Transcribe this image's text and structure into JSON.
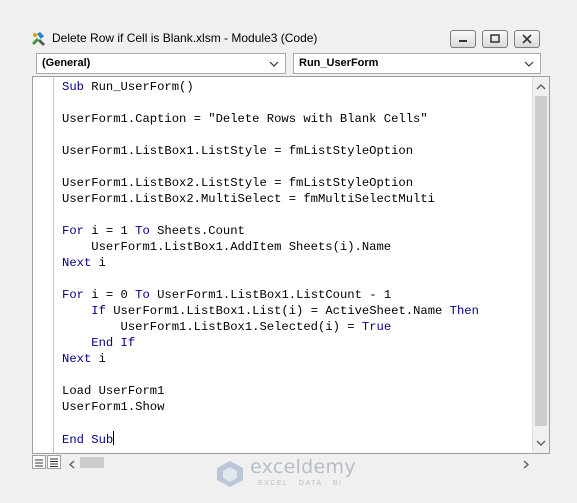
{
  "window": {
    "title": "Delete Row if Cell is Blank.xlsm - Module3 (Code)"
  },
  "combos": {
    "object": "(General)",
    "procedure": "Run_UserForm"
  },
  "code": {
    "lines": [
      [
        {
          "t": "Sub",
          "k": true
        },
        {
          "t": " Run_UserForm()"
        }
      ],
      [],
      [
        {
          "t": "UserForm1.Caption = \"Delete Rows with Blank Cells\""
        }
      ],
      [],
      [
        {
          "t": "UserForm1.ListBox1.ListStyle = fmListStyleOption"
        }
      ],
      [],
      [
        {
          "t": "UserForm1.ListBox2.ListStyle = fmListStyleOption"
        }
      ],
      [
        {
          "t": "UserForm1.ListBox2.MultiSelect = fmMultiSelectMulti"
        }
      ],
      [],
      [
        {
          "t": "For",
          "k": true
        },
        {
          "t": " i = 1 "
        },
        {
          "t": "To",
          "k": true
        },
        {
          "t": " Sheets.Count"
        }
      ],
      [
        {
          "t": "    UserForm1.ListBox1.AddItem Sheets(i).Name"
        }
      ],
      [
        {
          "t": "Next",
          "k": true
        },
        {
          "t": " i"
        }
      ],
      [],
      [
        {
          "t": "For",
          "k": true
        },
        {
          "t": " i = 0 "
        },
        {
          "t": "To",
          "k": true
        },
        {
          "t": " UserForm1.ListBox1.ListCount - 1"
        }
      ],
      [
        {
          "t": "    "
        },
        {
          "t": "If",
          "k": true
        },
        {
          "t": " UserForm1.ListBox1.List(i) = ActiveSheet.Name "
        },
        {
          "t": "Then",
          "k": true
        }
      ],
      [
        {
          "t": "        UserForm1.ListBox1.Selected(i) = "
        },
        {
          "t": "True",
          "k": true
        }
      ],
      [
        {
          "t": "    "
        },
        {
          "t": "End If",
          "k": true
        }
      ],
      [
        {
          "t": "Next",
          "k": true
        },
        {
          "t": " i"
        }
      ],
      [],
      [
        {
          "t": "Load UserForm1"
        }
      ],
      [
        {
          "t": "UserForm1.Show"
        }
      ],
      [],
      [
        {
          "t": "End Sub",
          "k": true
        }
      ]
    ],
    "keyword_color": "#00008b",
    "caret_line": 22
  },
  "watermark": {
    "name": "exceldemy",
    "tagline": "EXCEL · DATA · BI"
  }
}
